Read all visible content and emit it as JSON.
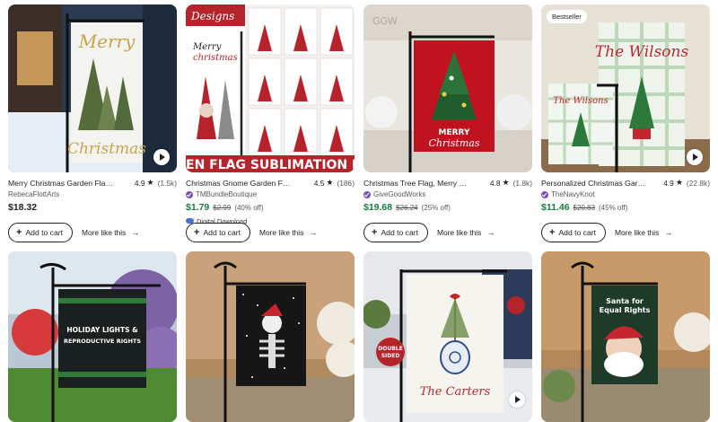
{
  "listings_row1": [
    {
      "title": "Merry Christmas Garden Flag-C...",
      "rating": "4.9",
      "reviews": "(1.5k)",
      "shop": "RebecaFlottArts",
      "star_seller": false,
      "price": "$18.32",
      "sale": false,
      "flag_text_1": "Merry",
      "flag_text_2": "Christmas",
      "has_play": true
    },
    {
      "title": "Christmas Gnome Garden Flag B...",
      "rating": "4.5",
      "reviews": "(186)",
      "shop": "TMBundleBoutique",
      "star_seller": true,
      "price": "$1.79",
      "orig_price": "$2.99",
      "discount": "(40% off)",
      "sale": true,
      "digital": "Digital Download",
      "banner_text": "EN FLAG SUBLIMATION BU",
      "design_text": "Designs",
      "flag_text_1": "Merry",
      "flag_text_2": "christmas"
    },
    {
      "title": "Christmas Tree Flag, Merry Chri...",
      "rating": "4.8",
      "reviews": "(1.8k)",
      "shop": "GiveGoodWorks",
      "star_seller": true,
      "price": "$19.68",
      "orig_price": "$26.24",
      "discount": "(25% off)",
      "sale": true,
      "flag_text_1": "MERRY",
      "flag_text_2": "Christmas",
      "watermark": "GGW"
    },
    {
      "title": "Personalized Christmas Garden ...",
      "rating": "4.9",
      "reviews": "(22.8k)",
      "shop": "TheNavyKnot",
      "star_seller": true,
      "price": "$11.46",
      "orig_price": "$20.83",
      "discount": "(45% off)",
      "sale": true,
      "badge": "Bestseller",
      "flag_text_big": "The Wilsons",
      "flag_text_small": "The Wilsons",
      "has_play": true
    }
  ],
  "buttons": {
    "add_to_cart": "Add to cart",
    "more_like_this": "More like this"
  },
  "row2_flags": [
    {
      "line1": "HOLIDAY LIGHTS &",
      "line2": "REPRODUCTIVE RIGHTS"
    },
    {
      "line1": ""
    },
    {
      "name": "The Carters",
      "badge_1": "DOUBLE",
      "badge_2": "SIDED",
      "has_play": true
    },
    {
      "line1": "Santa for",
      "line2": "Equal Rights"
    }
  ],
  "colors": {
    "sale_green": "#1b7a3e",
    "star_seller_purple": "#7b4fb8",
    "text": "#222222",
    "muted": "#595959"
  }
}
